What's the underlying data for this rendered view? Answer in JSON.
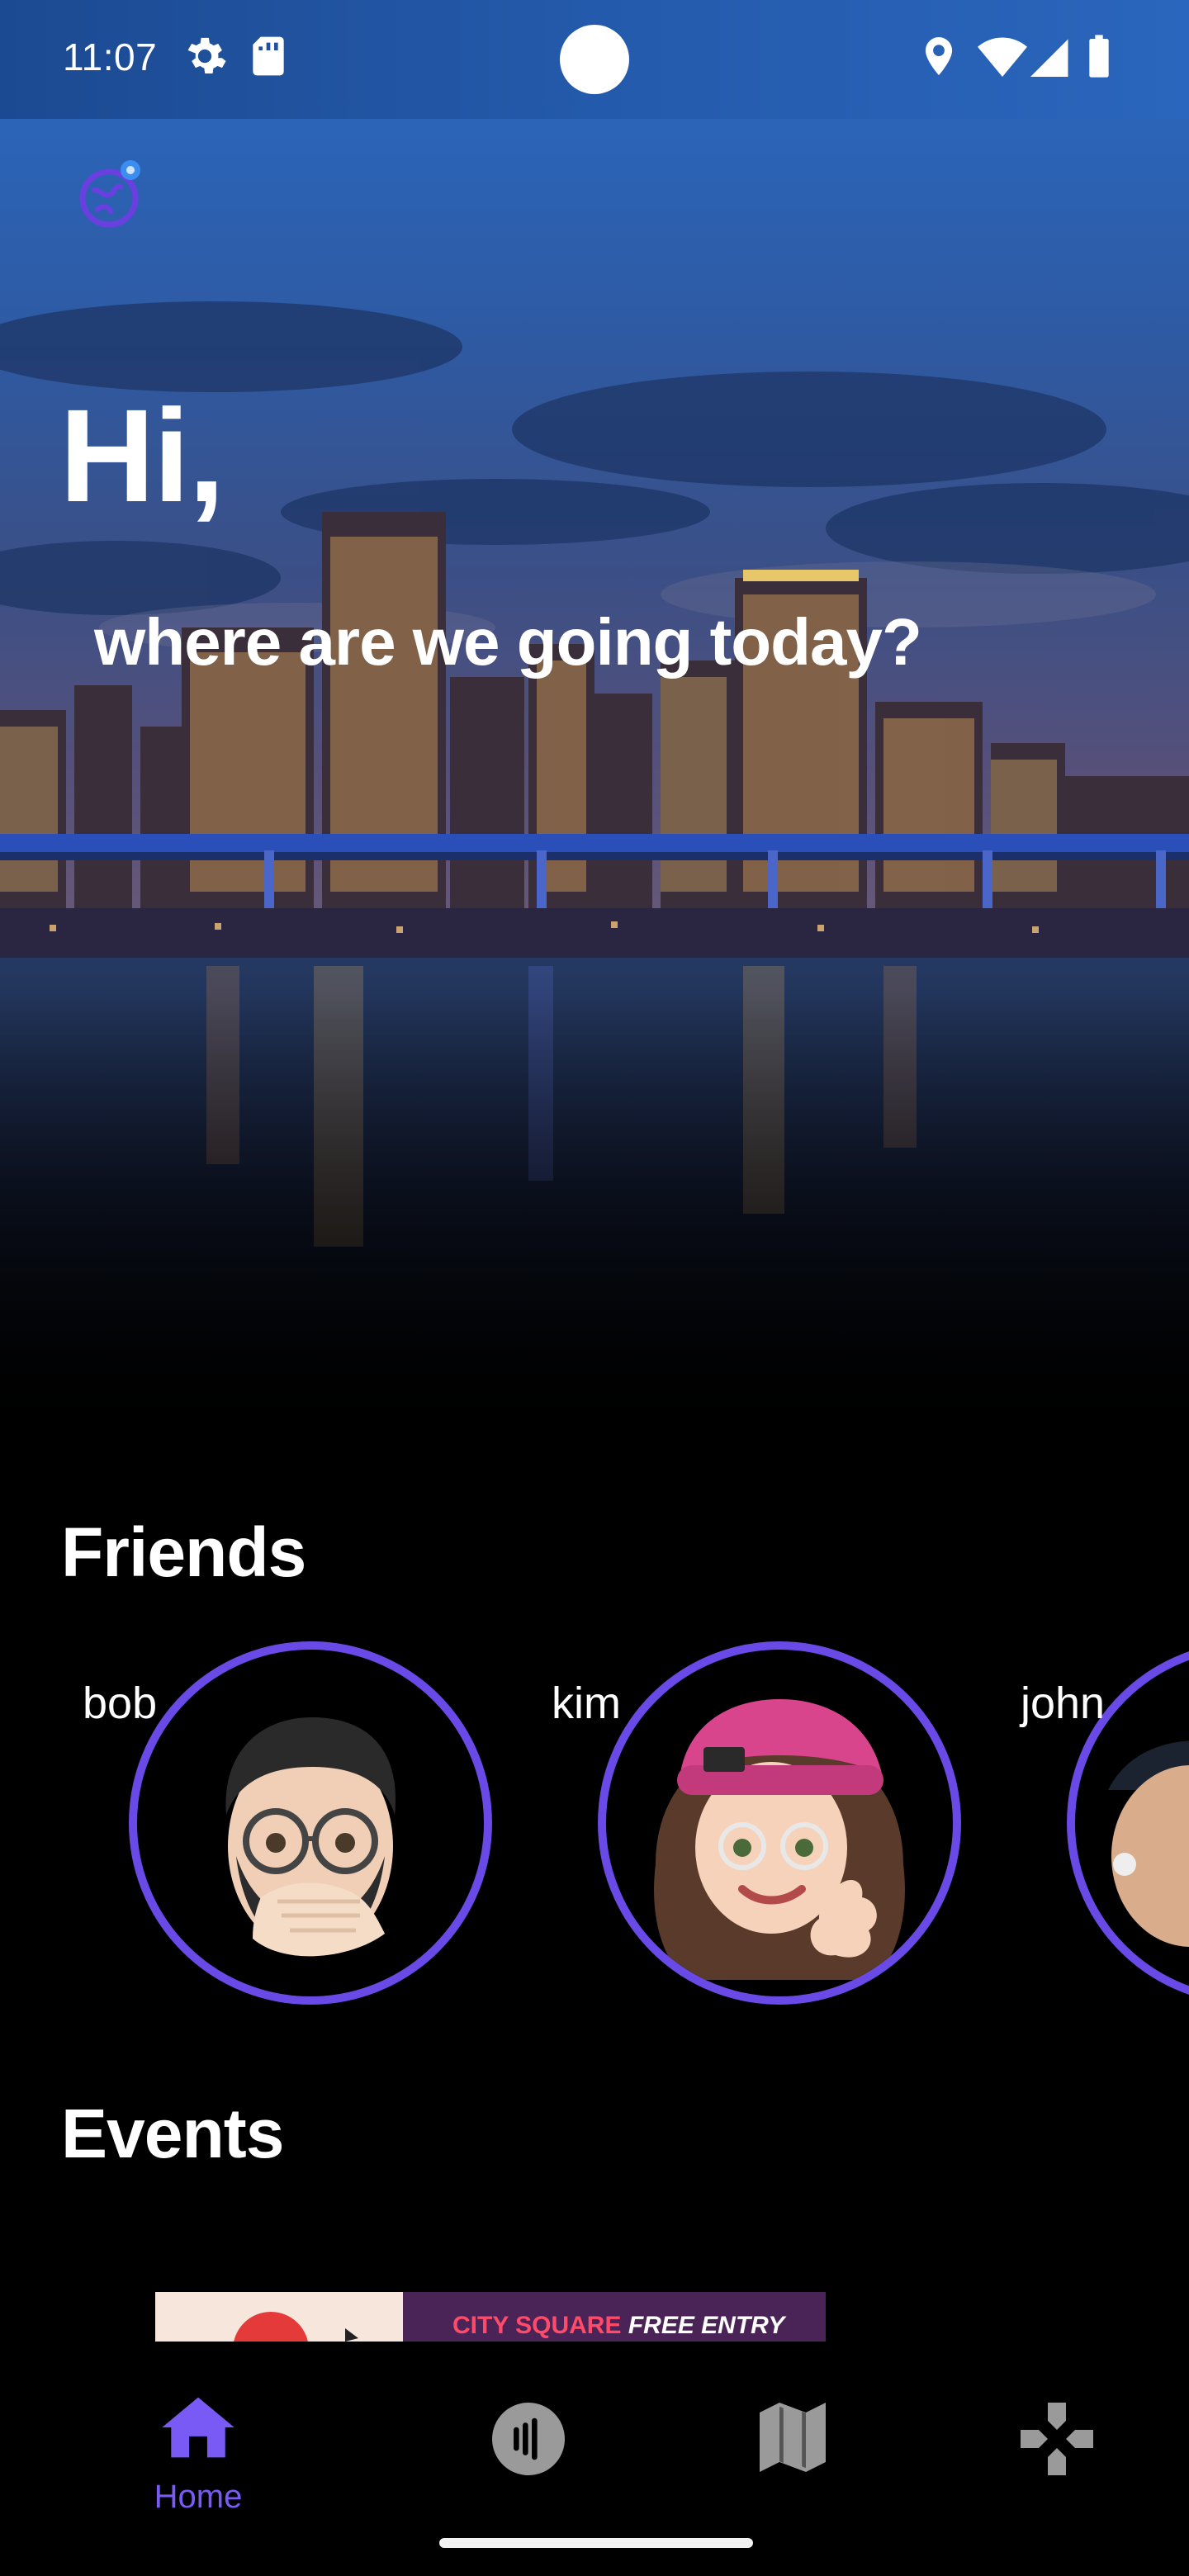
{
  "status_bar": {
    "time": "11:07",
    "icons": [
      "gear-icon",
      "sd-card-icon",
      "location-icon",
      "wifi-icon",
      "signal-icon",
      "battery-icon"
    ]
  },
  "app": {
    "logo_icon": "globe-pin-icon"
  },
  "greeting": {
    "title": "Hi,",
    "subtitle": "where are we going today?"
  },
  "friends": {
    "title": "Friends",
    "items": [
      {
        "name": "bob",
        "avatar": "memoji-man-glasses"
      },
      {
        "name": "kim",
        "avatar": "memoji-woman-pink-beanie"
      },
      {
        "name": "john",
        "avatar": "memoji-man-cap"
      }
    ]
  },
  "events": {
    "title": "Events",
    "cards": [
      {
        "text_accent": "CITY SQUARE",
        "text": "FREE ENTRY"
      }
    ]
  },
  "bottom_nav": {
    "items": [
      {
        "label": "Home",
        "icon": "home-icon",
        "active": true
      },
      {
        "label": "",
        "icon": "nfc-icon",
        "active": false
      },
      {
        "label": "",
        "icon": "map-icon",
        "active": false
      },
      {
        "label": "",
        "icon": "gamepad-icon",
        "active": false
      }
    ]
  },
  "colors": {
    "accent": "#7a5af5",
    "ring": "#6a4ae6",
    "status_bar": "#245aab",
    "background": "#000000",
    "inactive_icon": "#9a9a9a"
  }
}
